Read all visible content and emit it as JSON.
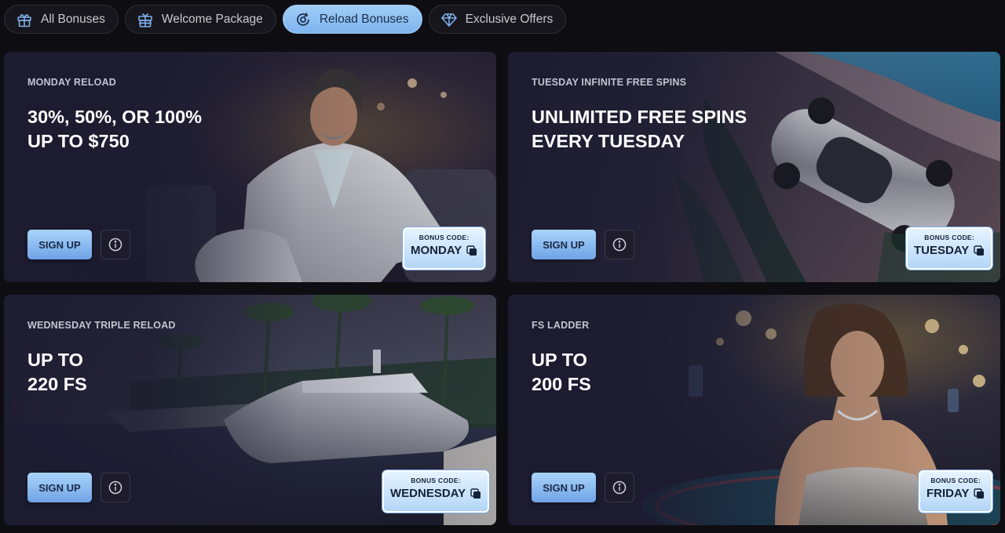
{
  "tabs": [
    {
      "label": "All Bonuses",
      "icon": "gift-icon",
      "active": false
    },
    {
      "label": "Welcome Package",
      "icon": "gift-box-icon",
      "active": false
    },
    {
      "label": "Reload Bonuses",
      "icon": "reload-icon",
      "active": true
    },
    {
      "label": "Exclusive Offers",
      "icon": "diamond-icon",
      "active": false
    }
  ],
  "cards": [
    {
      "eyebrow": "MONDAY RELOAD",
      "headline_1": "30%, 50%, OR 100%",
      "headline_2": "UP TO $750",
      "signup": "SIGN UP",
      "code_label": "BONUS CODE:",
      "code_value": "MONDAY",
      "image": "man-in-white-suit"
    },
    {
      "eyebrow": "TUESDAY INFINITE FREE SPINS",
      "headline_1": "UNLIMITED FREE SPINS",
      "headline_2": "EVERY TUESDAY",
      "signup": "SIGN UP",
      "code_label": "BONUS CODE:",
      "code_value": "TUESDAY",
      "image": "silver-sports-car"
    },
    {
      "eyebrow": "WEDNESDAY TRIPLE RELOAD",
      "headline_1": "UP TO",
      "headline_2": "220 FS",
      "signup": "SIGN UP",
      "code_label": "BONUS CODE:",
      "code_value": "WEDNESDAY",
      "image": "yacht-at-marina"
    },
    {
      "eyebrow": "FS LADDER",
      "headline_1": "UP TO",
      "headline_2": "200 FS",
      "signup": "SIGN UP",
      "code_label": "BONUS CODE:",
      "code_value": "FRIDAY",
      "image": "woman-at-casino"
    }
  ],
  "colors": {
    "background": "#0e0d12",
    "card": "#1c1a2c",
    "accent": "#8fc2f4",
    "tab_active_text": "#1c2e4a"
  }
}
